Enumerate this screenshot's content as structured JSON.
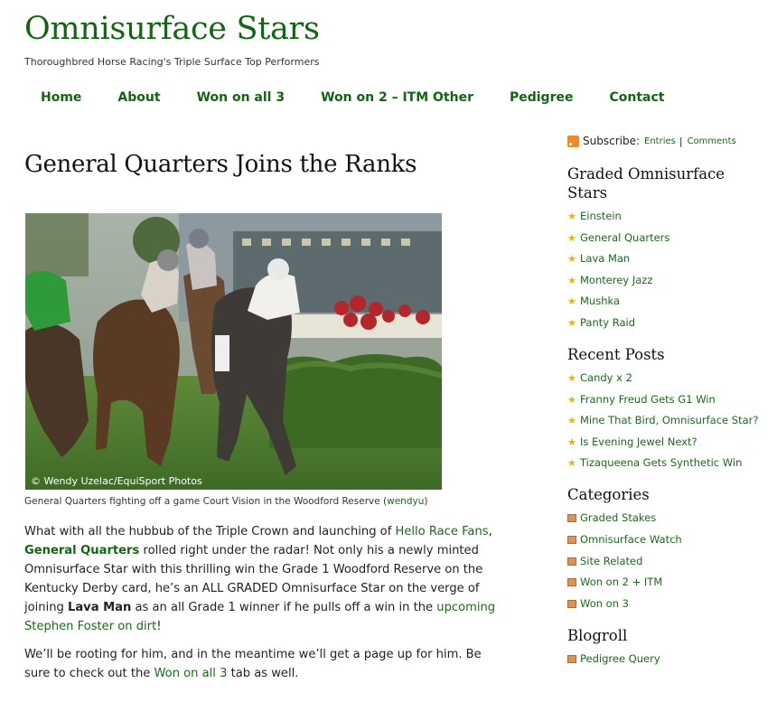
{
  "site": {
    "title": "Omnisurface Stars",
    "tagline": "Thoroughbred Horse Racing's Triple Surface Top Performers"
  },
  "nav": [
    "Home",
    "About",
    "Won on all 3",
    "Won on 2 – ITM Other",
    "Pedigree",
    "Contact"
  ],
  "post": {
    "title": "General Quarters Joins the Ranks",
    "photo_credit": "© Wendy Uzelac/EquiSport Photos",
    "caption_text": "General Quarters fighting off a game Court Vision in the Woodford Reserve (",
    "caption_link": "wendyu",
    "caption_end": ")",
    "p1": {
      "t1": "What with all the hubbub of the Triple Crown and launching of ",
      "link1": "Hello Race Fans",
      "t2": ", ",
      "link2": "General Quarters",
      "t3": " rolled right under the radar! Not only his a newly minted Omnisurface Star with this thrilling win the Grade 1 Woodford Reserve on the Kentucky Derby card, he’s an ALL GRADED Omnisurface Star on the verge of joining ",
      "bold": "Lava Man",
      "t4": " as an all Grade 1 winner if he pulls off a win in the ",
      "link3": "upcoming Stephen Foster on dirt",
      "t5": "!"
    },
    "p2": {
      "t1": "We’ll be rooting for him, and in the meantime we’ll get a page up for him. Be sure to check out the ",
      "link": "Won on all 3",
      "t2": " tab as well."
    }
  },
  "sidebar": {
    "subscribe_label": "Subscribe:",
    "entries": "Entries",
    "separator": "|",
    "comments": "Comments",
    "graded_title": "Graded Omnisurface Stars",
    "graded": [
      "Einstein",
      "General Quarters",
      "Lava Man",
      "Monterey Jazz",
      "Mushka",
      "Panty Raid"
    ],
    "recent_title": "Recent Posts",
    "recent": [
      "Candy x 2",
      "Franny Freud Gets G1 Win",
      "Mine That Bird, Omnisurface Star?",
      "Is Evening Jewel Next?",
      "Tizaqueena Gets Synthetic Win"
    ],
    "categories_title": "Categories",
    "categories": [
      "Graded Stakes",
      "Omnisurface Watch",
      "Site Related",
      "Won on 2 + ITM",
      "Won on 3"
    ],
    "blogroll_title": "Blogroll",
    "blogroll": [
      "Pedigree Query"
    ]
  },
  "colors": {
    "brand_green": "#116611",
    "link_green": "#1a6b1a",
    "star": "#e8b400"
  },
  "icons": {
    "list_bullet": "star-icon",
    "category_bullet": "folder-icon",
    "feed": "rss-icon"
  }
}
